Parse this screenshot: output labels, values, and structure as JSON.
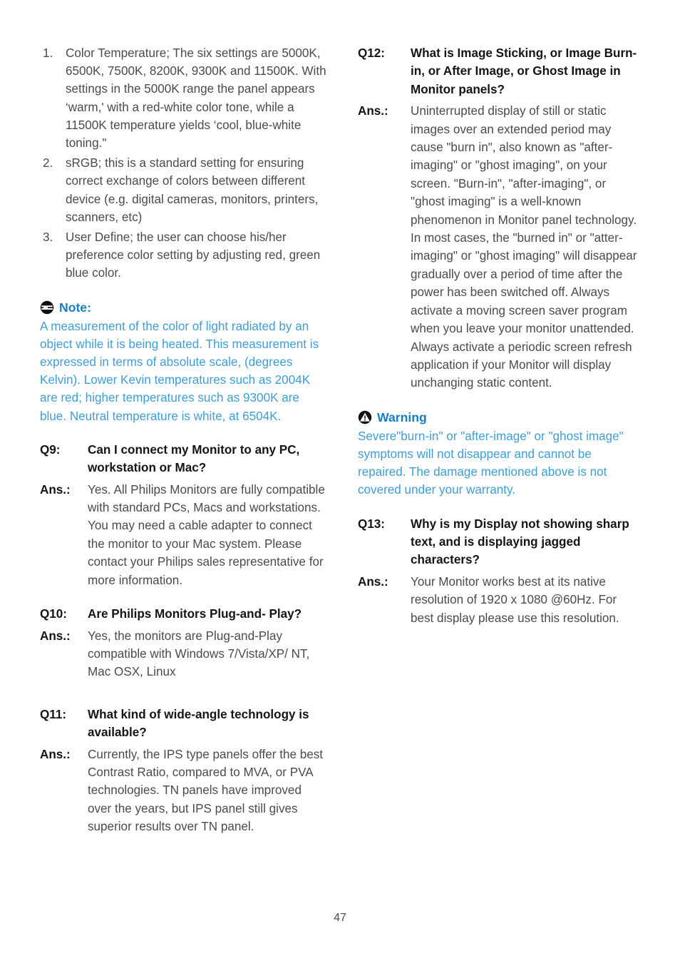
{
  "document": {
    "page_number": "47",
    "colors": {
      "body_text": "#4b4b4b",
      "heading_text": "#151515",
      "note_title_blue": "#1a7fc2",
      "note_body_blue": "#3f9ed8"
    }
  },
  "left_column": {
    "numbered_list": [
      {
        "marker": "1.",
        "text": "Color Temperature; The six settings are 5000K, 6500K, 7500K, 8200K, 9300K and 11500K. With settings in the 5000K range the panel appears ‘warm,' with a red-white color tone, while a 11500K temperature yields ‘cool, blue-white toning.\""
      },
      {
        "marker": "2.",
        "text": "sRGB; this is a standard setting for ensuring correct exchange of colors between different device (e.g. digital cameras, monitors, printers, scanners, etc)"
      },
      {
        "marker": "3.",
        "text": "User Define; the user can choose his/her preference color setting by adjusting red, green blue color."
      }
    ],
    "note": {
      "icon": "note-icon",
      "title": "Note:",
      "body": "A measurement of the color of light radiated by an object while it is being heated. This measurement is expressed in terms of absolute scale, (degrees Kelvin). Lower Kevin temperatures such as 2004K are red; higher temperatures such as 9300K are blue. Neutral temperature is white, at 6504K."
    },
    "qa": [
      {
        "q_label": "Q9:",
        "q_text": "Can I connect my Monitor to any PC, workstation or Mac?",
        "a_label": "Ans.:",
        "a_text": "Yes. All Philips Monitors are fully compatible with standard PCs, Macs and workstations. You may need a cable adapter to connect the monitor to your Mac system. Please contact your Philips sales representative for more information."
      },
      {
        "q_label": "Q10:",
        "q_text": "Are Philips Monitors Plug-and- Play?",
        "a_label": "Ans.:",
        "a_text": "Yes, the monitors are Plug-and-Play compatible with Windows 7/Vista/XP/ NT, Mac OSX, Linux"
      },
      {
        "q_label": "Q11:",
        "q_text": "What kind of wide-angle technology is available?",
        "a_label": "Ans.:",
        "a_text": "Currently, the IPS type panels offer the best Contrast Ratio, compared to MVA, or PVA technologies.  TN panels have improved over the years, but IPS panel still gives superior results over TN panel."
      }
    ]
  },
  "right_column": {
    "qa_top": {
      "q_label": "Q12:",
      "q_text": "What is Image Sticking, or Image Burn-in, or After Image, or Ghost Image in Monitor panels?",
      "a_label": "Ans.:",
      "a_text": "Uninterrupted display of still or static images over an extended period may cause \"burn in\", also known as \"after-imaging\" or \"ghost imaging\", on your screen. \"Burn-in\", \"after-imaging\", or \"ghost imaging\" is a well-known phenomenon in Monitor panel technology. In most cases, the \"burned in\" or \"atter-imaging\" or \"ghost imaging\" will disappear gradually over a period of time after the power has been switched off.\nAlways activate a moving screen saver program when you leave your monitor unattended.\nAlways activate a periodic screen refresh application if your Monitor will display unchanging static content."
    },
    "warning": {
      "icon": "warning-icon",
      "title": "Warning",
      "body": "Severe\"burn-in\" or \"after-image\" or \"ghost image\" symptoms will not disappear and cannot be repaired. The damage mentioned above is not covered under your warranty."
    },
    "qa_bottom": {
      "q_label": "Q13:",
      "q_text": "Why is my Display not showing sharp text, and is displaying jagged characters?",
      "a_label": "Ans.:",
      "a_text": "Your Monitor works best at its native resolution of 1920 x 1080 @60Hz. For best display please use this resolution."
    }
  }
}
